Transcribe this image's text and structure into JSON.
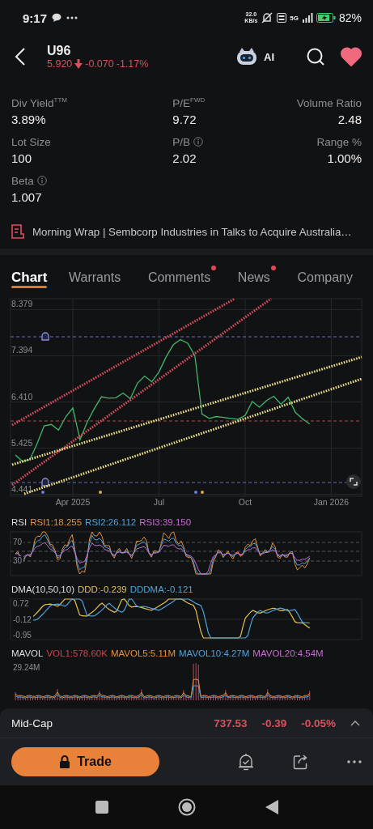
{
  "status_bar": {
    "time": "9:17",
    "network_speed": "32.0",
    "speed_unit": "KB/s",
    "network": "5G",
    "battery": "82%"
  },
  "header": {
    "symbol": "U96",
    "price": "5.920",
    "change": "-0.070",
    "change_pct": "-1.17%",
    "ai_label": "AI",
    "favorited": true
  },
  "stats": [
    {
      "label": "Div Yield$^{TTM}$",
      "value": "3.89%"
    },
    {
      "label": "P/E$^{FWD}$",
      "value": "9.72"
    },
    {
      "label": "Volume Ratio",
      "value": "2.48"
    },
    {
      "label": "Lot Size",
      "value": "100"
    },
    {
      "label": "P/B",
      "value": "2.02",
      "info": true
    },
    {
      "label": "Range %",
      "value": "1.00%"
    },
    {
      "label": "Beta",
      "value": "1.007",
      "info": true
    }
  ],
  "news": {
    "headline": "Morning Wrap | Sembcorp Industries in Talks to Acquire Australia…"
  },
  "tabs": [
    {
      "label": "Chart",
      "selected": true,
      "dot": false
    },
    {
      "label": "Warrants",
      "selected": false,
      "dot": false
    },
    {
      "label": "Comments",
      "selected": false,
      "dot": true
    },
    {
      "label": "News",
      "selected": false,
      "dot": true
    },
    {
      "label": "Company",
      "selected": false,
      "dot": false
    }
  ],
  "chart_data": {
    "type": "line",
    "categories": [
      null,
      null,
      null,
      null,
      null,
      null,
      null,
      null,
      "Apr 2025",
      null,
      null,
      null,
      null,
      null,
      null,
      null,
      null,
      null,
      null,
      null,
      "Jul",
      null,
      null,
      null,
      null,
      null,
      null,
      null,
      null,
      null,
      null,
      null,
      "Oct",
      null,
      null,
      null,
      null,
      null,
      null,
      null,
      null,
      null,
      null,
      null,
      "Jan 2026",
      null,
      null,
      null,
      null
    ],
    "series": [
      {
        "color": "#3fb86a",
        "values": [
          5.28,
          5.14,
          5.18,
          5.51,
          5.9,
          5.93,
          5.81,
          6.09,
          6.28,
          5.6,
          5.98,
          6.27,
          6.52,
          6.49,
          6.5,
          6.6,
          6.48,
          6.81,
          6.96,
          6.84,
          7.05,
          7.37,
          7.63,
          7.74,
          7.66,
          7.4,
          6.15,
          6.06,
          6.1,
          6.08,
          6.06,
          6.04,
          6.12,
          6.42,
          6.3,
          6.44,
          6.53,
          6.36,
          6.51,
          6.19,
          6.05,
          5.94,
          null,
          null,
          null,
          null,
          null,
          null,
          null
        ]
      }
    ],
    "ylim": [
      4.4,
      8.42
    ],
    "grid": true,
    "yticks": [
      {
        "value": 8.379,
        "label": "8.379"
      },
      {
        "value": 7.394,
        "label": "7.394"
      },
      {
        "value": 6.41,
        "label": "6.410"
      },
      {
        "value": 5.425,
        "label": "5.425"
      },
      {
        "value": 4.441,
        "label": "4.441"
      }
    ]
  },
  "indicators": [
    {
      "kind": "rsi",
      "name": "RSI",
      "values": [
        {
          "text": "RSI1:18.255",
          "color": "#e8913a"
        },
        {
          "text": "RSI2:26.112",
          "color": "#4fa3d9"
        },
        {
          "text": "RSI3:39.150",
          "color": "#c56fd0"
        }
      ],
      "axis_labels": [
        "70",
        "30"
      ]
    },
    {
      "kind": "dma",
      "name": "DMA(10,50,10)",
      "values": [
        {
          "text": "DDD:-0.239",
          "color": "#e8c14a"
        },
        {
          "text": "DDDMA:-0.121",
          "color": "#4fa3d9"
        }
      ],
      "axis_labels": [
        "0.72",
        "-0.12",
        "-0.95"
      ]
    },
    {
      "kind": "mavol",
      "name": "MAVOL",
      "values": [
        {
          "text": "VOL1:578.60K",
          "color": "#c8464f"
        },
        {
          "text": "MAVOL5:5.11M",
          "color": "#e8913a"
        },
        {
          "text": "MAVOL10:4.27M",
          "color": "#4fa3d9"
        },
        {
          "text": "MAVOL20:4.54M",
          "color": "#c56fd0"
        }
      ],
      "axis_labels": [
        "29.24M"
      ]
    }
  ],
  "index_bar": {
    "name": "Mid-Cap",
    "value": "737.53",
    "change": "-0.39",
    "change_pct": "-0.05%"
  },
  "actions": {
    "trade_label": "Trade"
  }
}
